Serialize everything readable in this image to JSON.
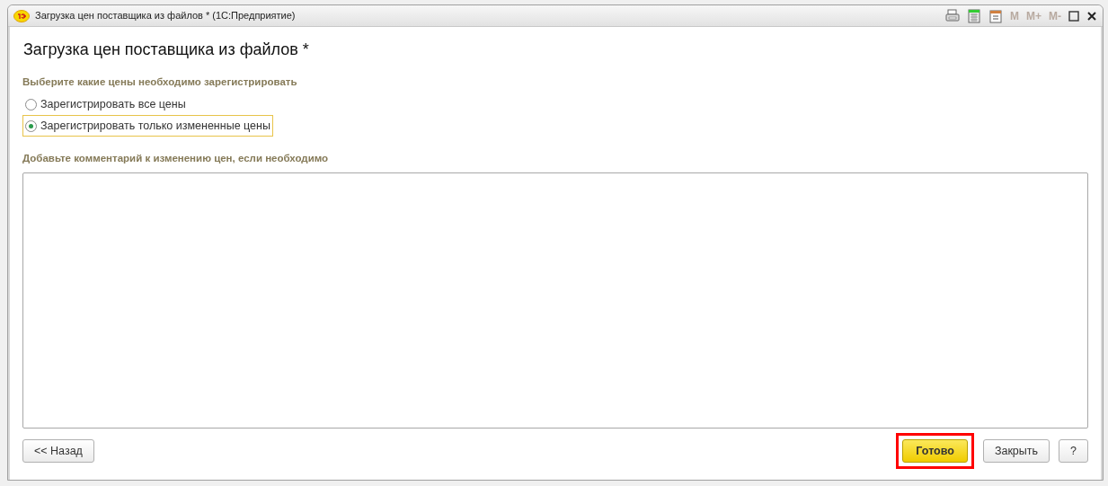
{
  "window": {
    "title": "Загрузка цен поставщика из файлов *  (1С:Предприятие)",
    "toolbar": [
      {
        "kind": "print"
      },
      {
        "kind": "calculator"
      },
      {
        "kind": "calendar"
      },
      {
        "kind": "text",
        "label": "M",
        "disabled": true
      },
      {
        "kind": "text",
        "label": "M+",
        "disabled": true
      },
      {
        "kind": "text",
        "label": "M-",
        "disabled": true
      }
    ]
  },
  "form": {
    "heading": "Загрузка цен поставщика из файлов *",
    "prices_group": {
      "label": "Выберите какие цены необходимо зарегистрировать",
      "options": [
        {
          "label": "Зарегистрировать все цены",
          "selected": false
        },
        {
          "label": "Зарегистрировать только измененные цены",
          "selected": true
        }
      ]
    },
    "comment": {
      "label": "Добавьте комментарий к изменению цен, если необходимо"
    }
  },
  "buttons": [
    {
      "label": "<< Назад",
      "kind": "default",
      "highlighted": false
    },
    {
      "label": "Готово",
      "kind": "primary",
      "highlighted": true
    },
    {
      "label": "Закрыть",
      "kind": "default",
      "highlighted": false
    },
    {
      "label": "?",
      "kind": "default",
      "highlighted": false
    }
  ]
}
